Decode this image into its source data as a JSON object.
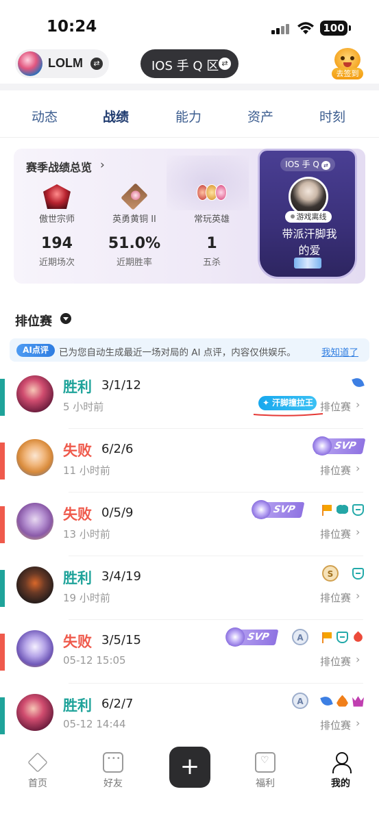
{
  "status_bar": {
    "time": "10:24",
    "battery": "100"
  },
  "header": {
    "game_name": "LOLM",
    "server_name": "IOS 手 Q 区",
    "checkin_label": "去签到"
  },
  "tabs": [
    {
      "label": "动态",
      "active": false
    },
    {
      "label": "战绩",
      "active": true
    },
    {
      "label": "能力",
      "active": false
    },
    {
      "label": "资产",
      "active": false
    },
    {
      "label": "时刻",
      "active": false
    }
  ],
  "season": {
    "title": "赛季战绩总览",
    "ranks": [
      {
        "label": "傲世宗师",
        "badge": "31"
      },
      {
        "label": "英勇黄铜 II"
      },
      {
        "label": "常玩英雄"
      }
    ],
    "stats": [
      {
        "value": "194",
        "label": "近期场次"
      },
      {
        "value": "51.0%",
        "label": "近期胜率"
      },
      {
        "value": "1",
        "label": "五杀"
      }
    ],
    "profile": {
      "server": "IOS 手 Q",
      "status": "游戏离线",
      "name_line1": "带派汗脚我",
      "name_line2": "的爱"
    }
  },
  "section": {
    "title": "排位赛"
  },
  "ai_banner": {
    "tag": "AI点评",
    "text": "已为您自动生成最近一场对局的 AI 点评，内容仅供娱乐。",
    "ack": "我知道了"
  },
  "matches": [
    {
      "result": "胜利",
      "kda": "3/1/12",
      "time": "5 小时前",
      "mode": "排位赛",
      "title_chip": "汗脚撞拉王"
    },
    {
      "result": "失败",
      "kda": "6/2/6",
      "time": "11 小时前",
      "mode": "排位赛",
      "svp": "SVP"
    },
    {
      "result": "失败",
      "kda": "0/5/9",
      "time": "13 小时前",
      "mode": "排位赛",
      "svp": "SVP"
    },
    {
      "result": "胜利",
      "kda": "3/4/19",
      "time": "19 小时前",
      "mode": "排位赛",
      "circle": "S"
    },
    {
      "result": "失败",
      "kda": "3/5/15",
      "time": "05-12 15:05",
      "mode": "排位赛",
      "svp": "SVP",
      "circle": "A"
    },
    {
      "result": "胜利",
      "kda": "6/2/7",
      "time": "05-12 14:44",
      "mode": "排位赛",
      "circle": "A"
    }
  ],
  "bottom_nav": [
    {
      "label": "首页",
      "icon": "home-icon"
    },
    {
      "label": "好友",
      "icon": "chat-icon"
    },
    {
      "label": "",
      "icon": "plus-icon"
    },
    {
      "label": "福利",
      "icon": "gift-icon"
    },
    {
      "label": "我的",
      "icon": "user-icon"
    }
  ],
  "colors": {
    "win": "#1fa39a",
    "loss": "#ef5a4c",
    "accent": "#2f7de1"
  }
}
